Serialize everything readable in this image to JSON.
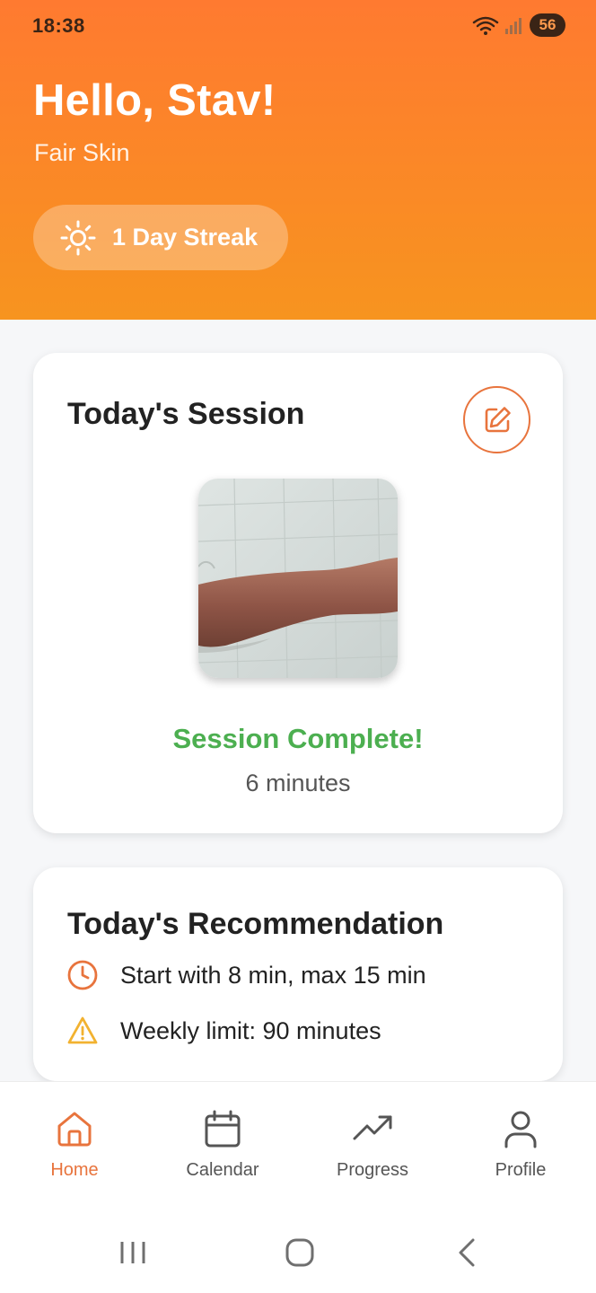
{
  "status_bar": {
    "time": "18:38",
    "battery": "56"
  },
  "header": {
    "greeting": "Hello, Stav!",
    "skin_type": "Fair Skin",
    "streak_label": "1 Day Streak",
    "streak_icon": "sun-icon"
  },
  "session_card": {
    "title": "Today's Session",
    "edit_icon": "edit-icon",
    "status": "Session Complete!",
    "duration": "6 minutes"
  },
  "recommendation_card": {
    "title": "Today's Recommendation",
    "items": [
      {
        "icon": "clock-icon",
        "text": "Start with 8 min, max 15 min"
      },
      {
        "icon": "warning-icon",
        "text": "Weekly limit: 90 minutes"
      }
    ]
  },
  "bottom_nav": {
    "items": [
      {
        "label": "Home",
        "icon": "home-icon",
        "active": true
      },
      {
        "label": "Calendar",
        "icon": "calendar-icon",
        "active": false
      },
      {
        "label": "Progress",
        "icon": "trending-up-icon",
        "active": false
      },
      {
        "label": "Profile",
        "icon": "user-icon",
        "active": false
      }
    ]
  },
  "colors": {
    "accent": "#e8743d",
    "header_gradient_top": "#ff7a30",
    "header_gradient_bottom": "#f7941f",
    "success": "#4caf50",
    "warning": "#f2b230"
  }
}
